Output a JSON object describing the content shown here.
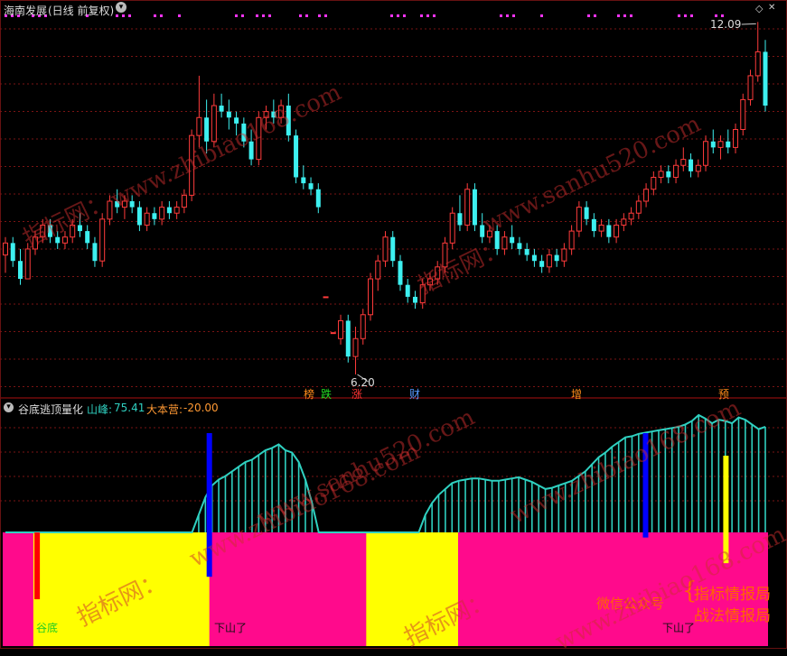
{
  "top_panel": {
    "stock_name": "海南发展",
    "period": "(日线 前复权)",
    "high_label": "12.09",
    "low_label": "6.20",
    "tags": [
      {
        "text": "榜",
        "color": "#ff8c1a"
      },
      {
        "text": "跌",
        "color": "#22dd22"
      },
      {
        "text": "涨",
        "color": "#ff3333"
      },
      {
        "text": "财",
        "color": "#5599ff"
      },
      {
        "text": "增",
        "color": "#ff8c1a"
      },
      {
        "text": "预",
        "color": "#ff8c1a"
      }
    ]
  },
  "bottom_panel": {
    "indicator_name": "谷底逃顶量化",
    "peak_label": "山峰:",
    "peak_value": "75.41",
    "camp_label": "大本营:",
    "camp_value": "-20.00",
    "zone_labels": [
      "谷底",
      "下山了",
      "下山了"
    ],
    "colors": {
      "peak": "#2fd0c0",
      "yellow_zone": "#ffff00",
      "magenta_zone": "#ff0a8c",
      "blue_bar": "#0000ff",
      "red_bar": "#ff0000"
    }
  },
  "promo": {
    "wechat_label": "微信公众号",
    "line1": "指标情报局",
    "line2": "战法情报局"
  },
  "watermarks": [
    "指标网：",
    "www.zhibiao168.com",
    "www.sanhu520.com",
    "指标网：",
    "www.zhibiao168.com",
    "www.sanhu520.com",
    "指标网：",
    "www.zhibiao168.com",
    "指标网：",
    "www.zhibiao168.com"
  ],
  "chart_data": {
    "type": "candlestick",
    "title": "海南发展 (日线 前复权)",
    "price_marks": {
      "high": 12.09,
      "low": 6.2
    },
    "ohlc": [
      [
        8.2,
        8.5,
        7.9,
        8.4
      ],
      [
        8.4,
        8.5,
        8.0,
        8.1
      ],
      [
        8.1,
        8.3,
        7.7,
        7.8
      ],
      [
        7.8,
        8.4,
        7.8,
        8.3
      ],
      [
        8.3,
        8.6,
        8.2,
        8.5
      ],
      [
        8.5,
        8.8,
        8.4,
        8.7
      ],
      [
        8.7,
        8.8,
        8.4,
        8.5
      ],
      [
        8.5,
        8.6,
        8.3,
        8.4
      ],
      [
        8.4,
        8.6,
        8.3,
        8.5
      ],
      [
        8.5,
        8.8,
        8.4,
        8.7
      ],
      [
        8.7,
        8.9,
        8.5,
        8.6
      ],
      [
        8.6,
        8.7,
        8.3,
        8.4
      ],
      [
        8.4,
        8.5,
        8.0,
        8.1
      ],
      [
        8.1,
        8.9,
        8.0,
        8.8
      ],
      [
        8.8,
        9.2,
        8.7,
        9.1
      ],
      [
        9.1,
        9.3,
        8.9,
        9.0
      ],
      [
        9.0,
        9.2,
        8.8,
        9.1
      ],
      [
        9.1,
        9.2,
        8.9,
        9.0
      ],
      [
        9.0,
        9.1,
        8.6,
        8.7
      ],
      [
        8.7,
        9.0,
        8.6,
        8.9
      ],
      [
        8.9,
        9.0,
        8.7,
        8.8
      ],
      [
        8.8,
        9.1,
        8.7,
        9.0
      ],
      [
        9.0,
        9.1,
        8.8,
        8.9
      ],
      [
        8.9,
        9.1,
        8.8,
        9.0
      ],
      [
        9.0,
        9.3,
        8.9,
        9.2
      ],
      [
        9.2,
        10.3,
        9.1,
        10.2
      ],
      [
        10.2,
        11.2,
        10.0,
        10.5
      ],
      [
        10.5,
        10.8,
        9.9,
        10.1
      ],
      [
        10.1,
        10.9,
        10.0,
        10.7
      ],
      [
        10.7,
        10.9,
        10.5,
        10.6
      ],
      [
        10.6,
        10.8,
        10.3,
        10.5
      ],
      [
        10.5,
        10.6,
        10.2,
        10.4
      ],
      [
        10.4,
        10.5,
        10.0,
        10.1
      ],
      [
        10.1,
        10.3,
        9.7,
        9.8
      ],
      [
        9.8,
        10.6,
        9.7,
        10.5
      ],
      [
        10.5,
        10.7,
        10.3,
        10.6
      ],
      [
        10.6,
        10.8,
        10.4,
        10.5
      ],
      [
        10.5,
        10.8,
        10.4,
        10.7
      ],
      [
        10.7,
        10.9,
        10.1,
        10.2
      ],
      [
        10.2,
        10.3,
        9.4,
        9.5
      ],
      [
        9.5,
        9.7,
        9.3,
        9.4
      ],
      [
        9.4,
        9.5,
        9.2,
        9.3
      ],
      [
        9.3,
        9.4,
        8.9,
        9.0
      ],
      [
        7.5,
        7.5,
        7.5,
        7.5
      ],
      [
        6.9,
        6.9,
        6.9,
        6.9
      ],
      [
        6.8,
        7.2,
        6.7,
        7.1
      ],
      [
        7.1,
        7.2,
        6.4,
        6.5
      ],
      [
        6.5,
        7.0,
        6.2,
        6.8
      ],
      [
        6.8,
        7.3,
        6.7,
        7.2
      ],
      [
        7.2,
        7.9,
        7.1,
        7.8
      ],
      [
        7.8,
        8.2,
        7.6,
        8.1
      ],
      [
        8.1,
        8.6,
        8.0,
        8.5
      ],
      [
        8.5,
        8.6,
        8.0,
        8.1
      ],
      [
        8.1,
        8.2,
        7.6,
        7.7
      ],
      [
        7.7,
        7.8,
        7.4,
        7.5
      ],
      [
        7.5,
        7.6,
        7.3,
        7.4
      ],
      [
        7.4,
        7.8,
        7.3,
        7.7
      ],
      [
        7.7,
        7.9,
        7.6,
        7.8
      ],
      [
        7.8,
        8.1,
        7.7,
        8.0
      ],
      [
        8.0,
        8.5,
        7.9,
        8.4
      ],
      [
        8.4,
        9.0,
        8.3,
        8.9
      ],
      [
        8.9,
        9.2,
        8.6,
        8.7
      ],
      [
        8.7,
        9.4,
        8.6,
        9.3
      ],
      [
        9.3,
        9.4,
        8.6,
        8.7
      ],
      [
        8.7,
        8.9,
        8.4,
        8.5
      ],
      [
        8.5,
        8.7,
        8.4,
        8.6
      ],
      [
        8.6,
        8.7,
        8.2,
        8.3
      ],
      [
        8.3,
        8.6,
        8.2,
        8.5
      ],
      [
        8.5,
        8.7,
        8.3,
        8.4
      ],
      [
        8.4,
        8.5,
        8.2,
        8.3
      ],
      [
        8.3,
        8.4,
        8.1,
        8.2
      ],
      [
        8.2,
        8.3,
        8.0,
        8.1
      ],
      [
        8.1,
        8.2,
        7.9,
        8.0
      ],
      [
        8.0,
        8.3,
        7.9,
        8.2
      ],
      [
        8.2,
        8.3,
        8.0,
        8.1
      ],
      [
        8.1,
        8.4,
        8.0,
        8.3
      ],
      [
        8.3,
        8.7,
        8.2,
        8.6
      ],
      [
        8.6,
        9.1,
        8.5,
        9.0
      ],
      [
        9.0,
        9.1,
        8.7,
        8.8
      ],
      [
        8.8,
        8.9,
        8.5,
        8.6
      ],
      [
        8.6,
        8.8,
        8.5,
        8.7
      ],
      [
        8.7,
        8.8,
        8.4,
        8.5
      ],
      [
        8.5,
        8.8,
        8.4,
        8.7
      ],
      [
        8.7,
        8.9,
        8.6,
        8.8
      ],
      [
        8.8,
        9.0,
        8.7,
        8.9
      ],
      [
        8.9,
        9.2,
        8.8,
        9.1
      ],
      [
        9.1,
        9.4,
        9.0,
        9.3
      ],
      [
        9.3,
        9.6,
        9.2,
        9.5
      ],
      [
        9.5,
        9.7,
        9.4,
        9.6
      ],
      [
        9.6,
        9.7,
        9.4,
        9.5
      ],
      [
        9.5,
        9.8,
        9.4,
        9.7
      ],
      [
        9.7,
        10.0,
        9.6,
        9.8
      ],
      [
        9.8,
        9.9,
        9.5,
        9.6
      ],
      [
        9.6,
        9.8,
        9.5,
        9.7
      ],
      [
        9.7,
        10.2,
        9.6,
        10.1
      ],
      [
        10.1,
        10.3,
        9.9,
        10.0
      ],
      [
        10.0,
        10.2,
        9.8,
        10.1
      ],
      [
        10.1,
        10.3,
        9.9,
        10.0
      ],
      [
        10.0,
        10.4,
        9.9,
        10.3
      ],
      [
        10.3,
        10.9,
        10.2,
        10.8
      ],
      [
        10.8,
        11.3,
        10.7,
        11.2
      ],
      [
        11.2,
        12.1,
        11.1,
        11.6
      ],
      [
        11.6,
        11.8,
        10.6,
        10.7
      ]
    ],
    "panel2": {
      "peak_series": [
        0,
        0,
        0,
        0,
        0,
        0,
        0,
        0,
        0,
        0,
        0,
        0,
        0,
        0,
        0,
        0,
        0,
        0,
        0,
        0,
        0,
        0,
        0,
        0,
        0,
        0,
        0,
        0,
        0,
        15,
        30,
        40,
        45,
        48,
        52,
        56,
        60,
        62,
        66,
        70,
        72,
        75,
        70,
        68,
        60,
        45,
        25,
        0,
        0,
        0,
        0,
        0,
        0,
        0,
        0,
        0,
        0,
        0,
        0,
        0,
        0,
        0,
        0,
        15,
        25,
        32,
        37,
        42,
        44,
        45,
        46,
        46,
        45,
        44,
        44,
        45,
        46,
        47,
        45,
        43,
        40,
        37,
        38,
        40,
        42,
        44,
        48,
        52,
        58,
        64,
        68,
        73,
        77,
        81,
        82,
        84,
        85,
        86,
        87,
        88,
        89,
        90,
        92,
        95,
        100,
        97,
        93,
        96,
        95,
        93,
        98,
        96,
        92,
        88,
        90
      ],
      "yellow_zones": [
        [
          0.04,
          0.27
        ],
        [
          0.475,
          0.595
        ]
      ],
      "blue_bars": [
        [
          0.27,
          0.0,
          0.7
        ],
        [
          0.84,
          0.0,
          0.53
        ]
      ],
      "red_bars": [
        [
          0.045,
          0.0,
          0.42
        ]
      ],
      "yellow_bars": [
        [
          0.945,
          0.0,
          0.52
        ]
      ]
    }
  }
}
